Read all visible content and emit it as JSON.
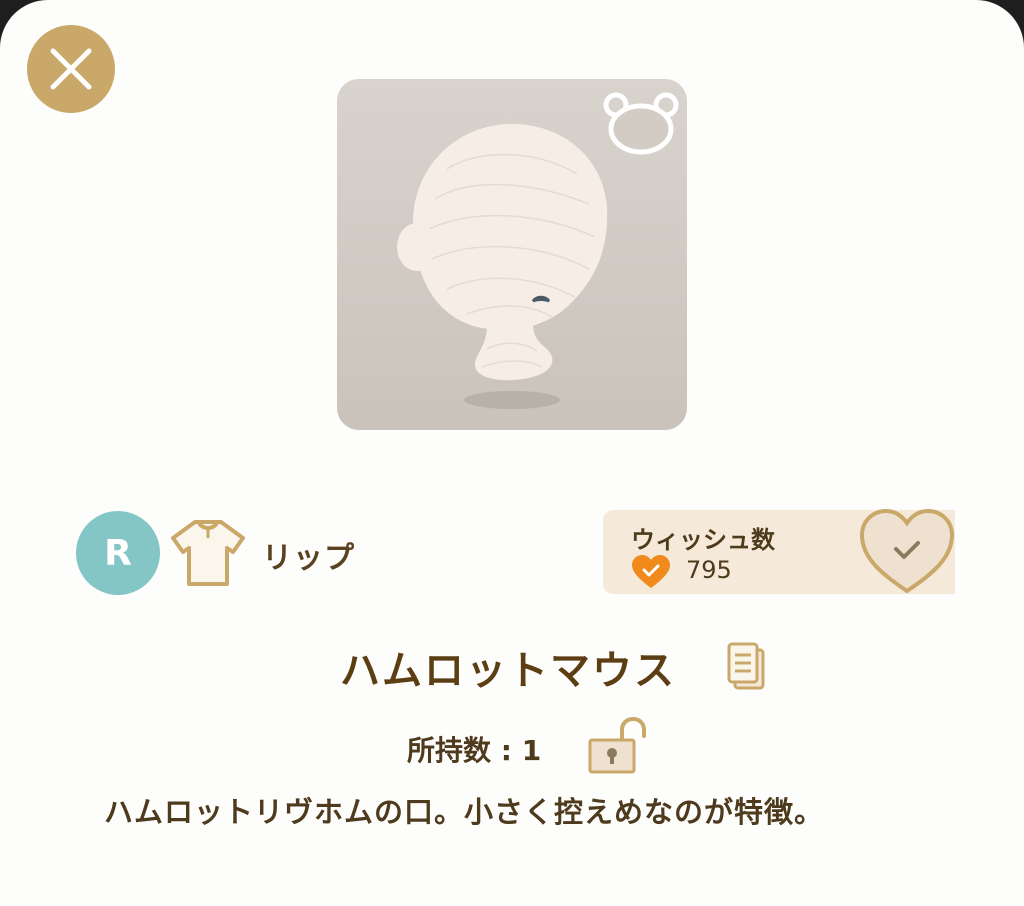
{
  "header": {
    "close_icon": "close-x-icon"
  },
  "item": {
    "image_badge_icon": "bear-face-icon",
    "rarity": "R",
    "category_icon": "shirt-icon",
    "category": "リップ",
    "name": "ハムロットマウス",
    "owned_label": "所持数 : 1",
    "description": "ハムロットリヴホムの口。小さく控えめなのが特徴。"
  },
  "wish": {
    "title": "ウィッシュ数",
    "count": "795",
    "small_icon": "orange-heart-check-icon",
    "button_icon": "heart-check-icon"
  },
  "colors": {
    "accent_gold": "#c9a86a",
    "rarity_teal": "#83c6c5",
    "text_brown": "#5c3e12",
    "wish_panel_bg": "#f5ead9",
    "wish_heart_orange": "#f08a1c"
  }
}
